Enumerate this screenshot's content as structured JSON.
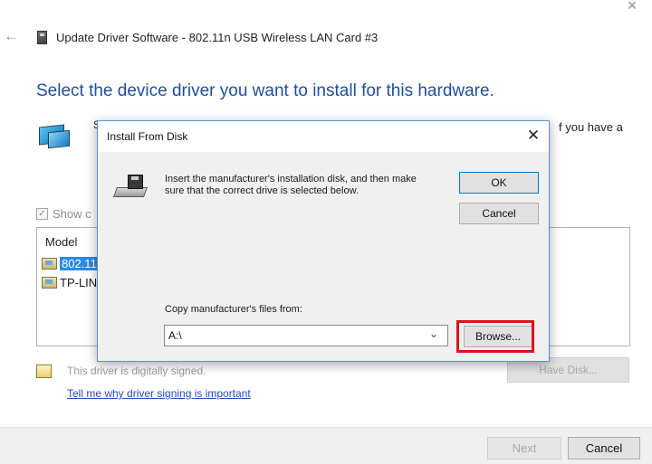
{
  "wizard": {
    "title": "Update Driver Software - 802.11n USB Wireless LAN Card #3",
    "heading": "Select the device driver you want to install for this hardware.",
    "description_fragment": "S",
    "description_tail": "f you have a",
    "show_compatible_label": "Show c",
    "model_header": "Model",
    "models": [
      {
        "label": "802.11",
        "selected": true
      },
      {
        "label": "TP-LIN",
        "selected": false
      }
    ],
    "signed_text": "This driver is digitally signed.",
    "signing_link": "Tell me why driver signing is important",
    "have_disk_label": "Have Disk...",
    "next_label": "Next",
    "cancel_label": "Cancel",
    "close_glyph": "×",
    "back_glyph": "←"
  },
  "dialog": {
    "title": "Install From Disk",
    "close_glyph": "✕",
    "message": "Insert the manufacturer's installation disk, and then make sure that the correct drive is selected below.",
    "ok_label": "OK",
    "cancel_label": "Cancel",
    "copy_label": "Copy manufacturer's files from:",
    "path_value": "A:\\",
    "combo_arrow": "⌄",
    "browse_label": "Browse..."
  },
  "colors": {
    "heading": "#1f4e9c",
    "link": "#1f4fb8",
    "selection": "#2d8be0",
    "highlight": "#d7141a"
  }
}
